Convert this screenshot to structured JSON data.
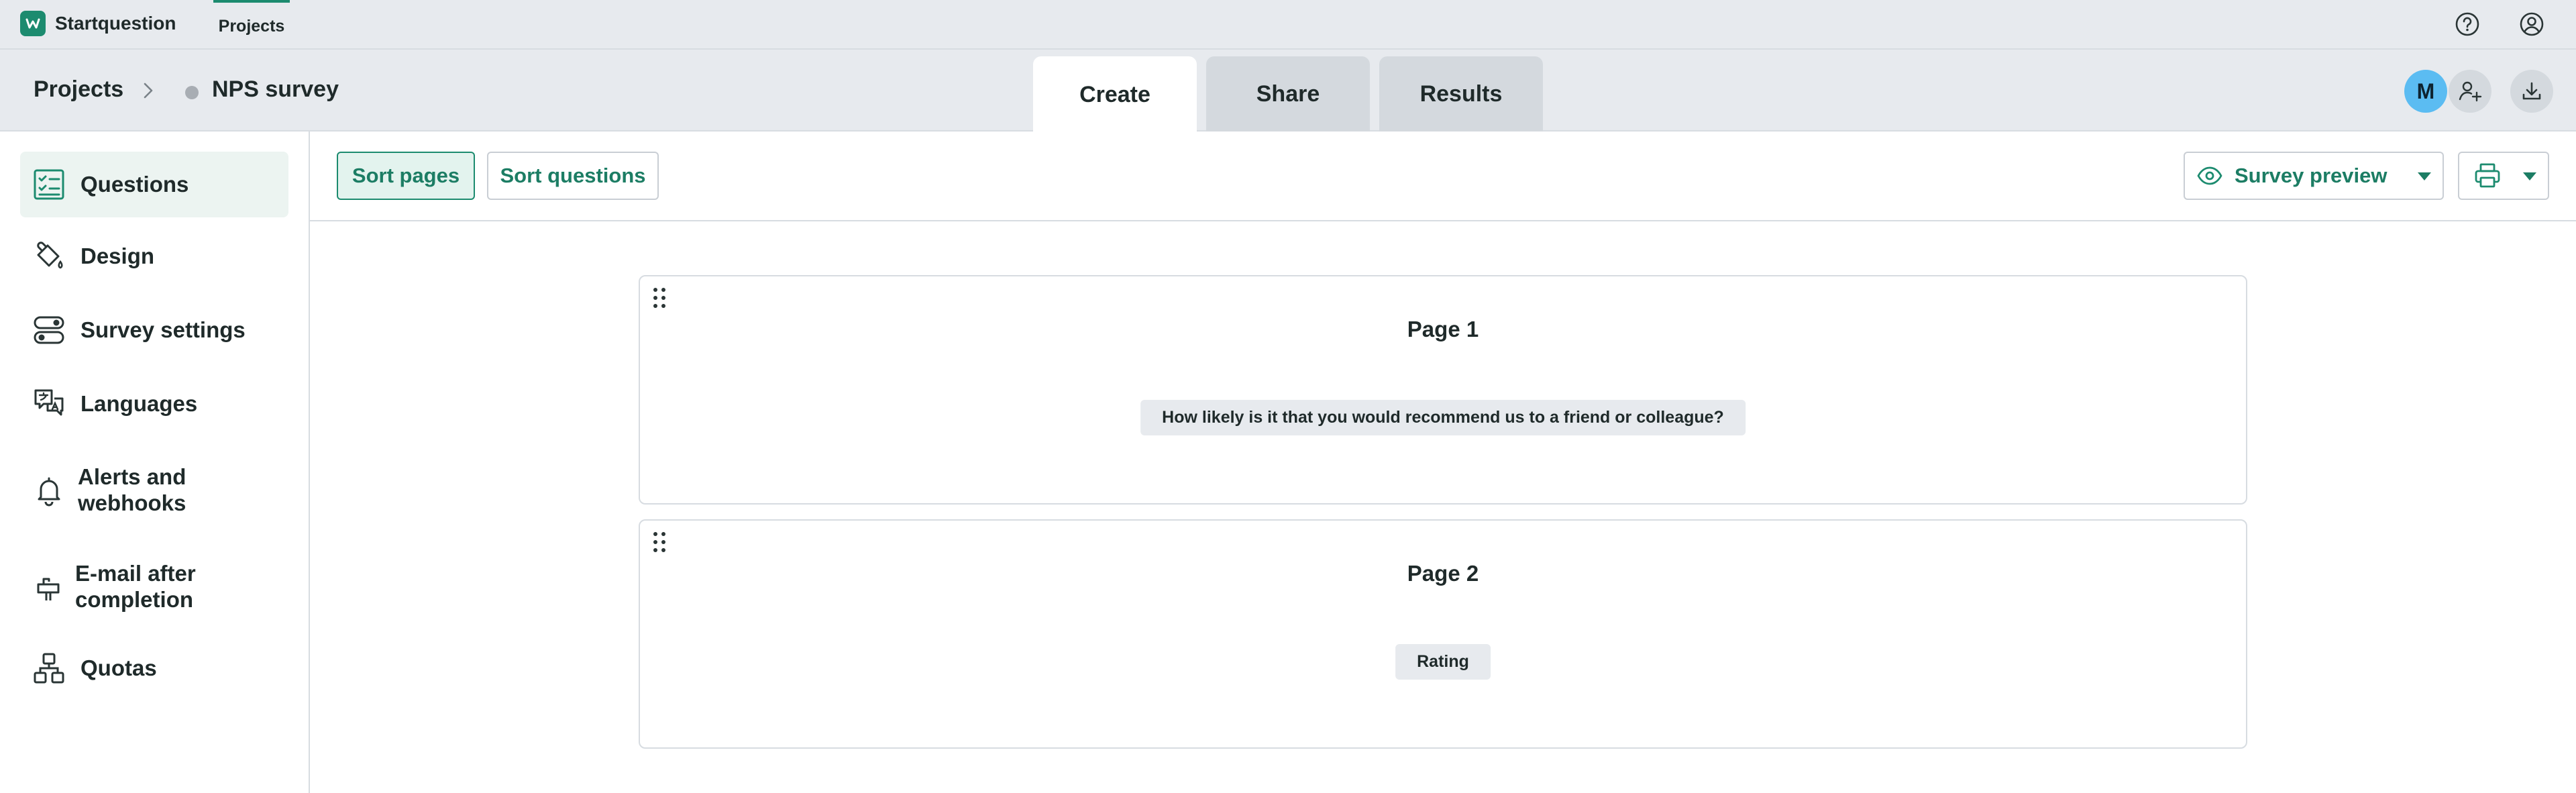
{
  "app": {
    "brand_name": "Startquestion",
    "top_nav": "Projects"
  },
  "breadcrumb": {
    "root": "Projects",
    "current": "NPS survey"
  },
  "tabs": [
    {
      "label": "Create",
      "active": true
    },
    {
      "label": "Share",
      "active": false
    },
    {
      "label": "Results",
      "active": false
    }
  ],
  "user": {
    "avatar_initial": "M"
  },
  "sidebar": {
    "items": [
      {
        "label": "Questions",
        "icon": "checklist-icon",
        "active": true
      },
      {
        "label": "Design",
        "icon": "paint-bucket-icon"
      },
      {
        "label": "Survey settings",
        "icon": "toggles-icon"
      },
      {
        "label": "Languages",
        "icon": "translate-icon"
      },
      {
        "label": "Alerts and webhooks",
        "icon": "bell-icon"
      },
      {
        "label": "E-mail after completion",
        "icon": "mailbox-icon"
      },
      {
        "label": "Quotas",
        "icon": "hierarchy-icon"
      }
    ]
  },
  "toolbar": {
    "sort_pages": "Sort pages",
    "sort_questions": "Sort questions",
    "survey_preview": "Survey preview"
  },
  "pages": [
    {
      "title": "Page 1",
      "question": "How likely is it that you would recommend us to a friend or colleague?"
    },
    {
      "title": "Page 2",
      "question": "Rating"
    }
  ],
  "colors": {
    "accent": "#1c8b6f",
    "avatar": "#5bbcf2",
    "chrome": "#e7eaee"
  }
}
